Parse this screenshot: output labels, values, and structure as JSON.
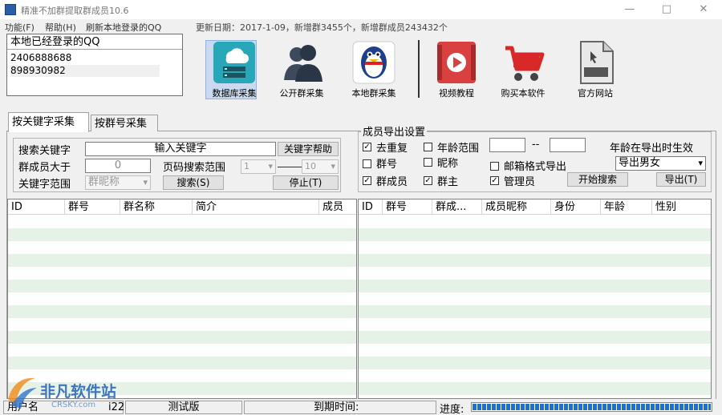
{
  "window": {
    "title": "精准不加群提取群成员10.6",
    "controls": [
      "—",
      "□",
      "✕"
    ]
  },
  "menu": {
    "items": [
      "功能(F)",
      "帮助(H)",
      "刷新本地登录的QQ"
    ],
    "update_info": "更新日期：2017-1-09，新增群3455个，新增群成员243432个"
  },
  "qq_panel": {
    "header": "本地已经登录的QQ",
    "accounts": [
      "2406888688",
      "898930982"
    ]
  },
  "toolbar": {
    "items": [
      {
        "label": "数据库采集",
        "icon": "database-cloud-icon"
      },
      {
        "label": "公开群采集",
        "icon": "people-icon"
      },
      {
        "label": "本地群采集",
        "icon": "qq-penguin-icon"
      },
      {
        "label": "视频教程",
        "icon": "video-play-icon"
      },
      {
        "label": "购买本软件",
        "icon": "shopping-cart-icon"
      },
      {
        "label": "官方网站",
        "icon": "html-file-icon"
      }
    ]
  },
  "tabs": [
    {
      "label": "按关键字采集"
    },
    {
      "label": "按群号采集"
    }
  ],
  "search": {
    "keyword_label": "搜索关键字",
    "keyword_placeholder": "输入关键字",
    "keyword_help": "关键字帮助",
    "members_label": "群成员大于",
    "members_value": "0",
    "page_range_label": "页码搜索范围",
    "page_from": "1",
    "page_to": "10",
    "scope_label": "关键字范围",
    "scope_value": "群昵称",
    "search_button": "搜索(S)",
    "stop_button": "停止(T)"
  },
  "export": {
    "title": "成员导出设置",
    "dedupe": {
      "label": "去重复",
      "checked": true
    },
    "age_range": {
      "label": "年龄范围",
      "checked": false,
      "from": "",
      "to": "",
      "separator": "--"
    },
    "age_note": "年龄在导出时生效",
    "group_no": {
      "label": "群号",
      "checked": false
    },
    "nickname": {
      "label": "昵称",
      "checked": false
    },
    "mail_format": {
      "label": "邮箱格式导出",
      "checked": false
    },
    "gender_select": "导出男女",
    "member": {
      "label": "群成员",
      "checked": true
    },
    "owner": {
      "label": "群主",
      "checked": true
    },
    "admin": {
      "label": "管理员",
      "checked": true
    },
    "start_button": "开始搜索",
    "export_button": "导出(T)"
  },
  "left_table": {
    "columns": [
      "ID",
      "群号",
      "群名称",
      "简介",
      "成员"
    ]
  },
  "right_table": {
    "columns": [
      "ID",
      "群号",
      "群成...",
      "成员昵称",
      "身份",
      "年龄",
      "性别"
    ]
  },
  "status": {
    "user_label": "用户名",
    "user_value": "i22",
    "version": "测试版",
    "expire_label": "到期时间:",
    "progress_label": "进度:",
    "progress": 1.0
  },
  "watermark": {
    "text": "非凡软件站",
    "subtext": "CRSKY.com"
  }
}
